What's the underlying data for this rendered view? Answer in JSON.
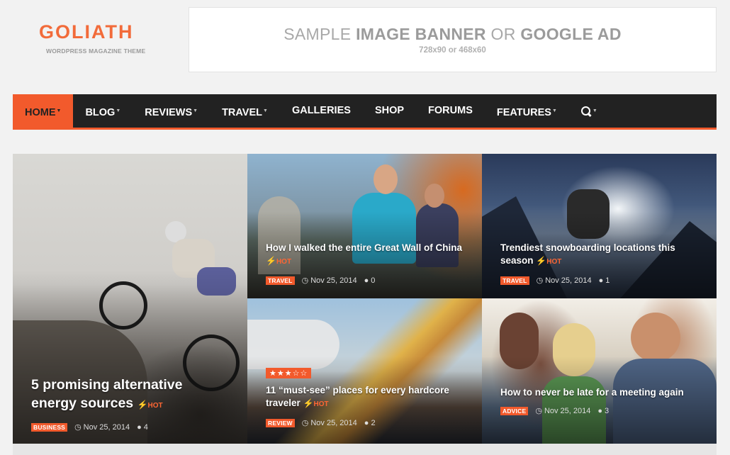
{
  "logo": {
    "title": "GOLIATH",
    "subtitle": "WORDPRESS MAGAZINE THEME"
  },
  "banner": {
    "title_light_1": "SAMPLE ",
    "title_bold_1": "IMAGE BANNER",
    "title_light_2": " OR ",
    "title_bold_2": "GOOGLE AD",
    "size": "728x90 or 468x60"
  },
  "nav": {
    "items": [
      {
        "label": "HOME",
        "caret": "▼"
      },
      {
        "label": "BLOG",
        "caret": "▼"
      },
      {
        "label": "REVIEWS",
        "caret": "▼"
      },
      {
        "label": "TRAVEL",
        "caret": "▼"
      },
      {
        "label": "GALLERIES",
        "caret": ""
      },
      {
        "label": "SHOP",
        "caret": ""
      },
      {
        "label": "FORUMS",
        "caret": ""
      },
      {
        "label": "FEATURES",
        "caret": "▼"
      }
    ],
    "search_caret": "▼",
    "accent": "#f25a2c"
  },
  "posts": [
    {
      "title": "5 promising alternative energy sources",
      "hot": "HOT",
      "category": "BUSINESS",
      "date": "Nov 25, 2014",
      "comments": "4"
    },
    {
      "title": "How I walked the entire Great Wall of China",
      "hot": "HOT",
      "category": "TRAVEL",
      "date": "Nov 25, 2014",
      "comments": "0"
    },
    {
      "title": "Trendiest snowboarding locations this season",
      "hot": "HOT",
      "category": "TRAVEL",
      "date": "Nov 25, 2014",
      "comments": "1"
    },
    {
      "title": "11 “must-see” places for every hardcore traveler",
      "hot": "HOT",
      "category": "REVIEW",
      "date": "Nov 25, 2014",
      "comments": "2",
      "stars": "★★★☆☆",
      "rating": 3
    },
    {
      "title": "How to never be late for a meeting again",
      "category": "ADVICE",
      "date": "Nov 25, 2014",
      "comments": "3"
    }
  ],
  "icons": {
    "hot": "bolt-icon",
    "date": "clock-icon",
    "comments": "comment-icon",
    "search": "search-icon"
  }
}
